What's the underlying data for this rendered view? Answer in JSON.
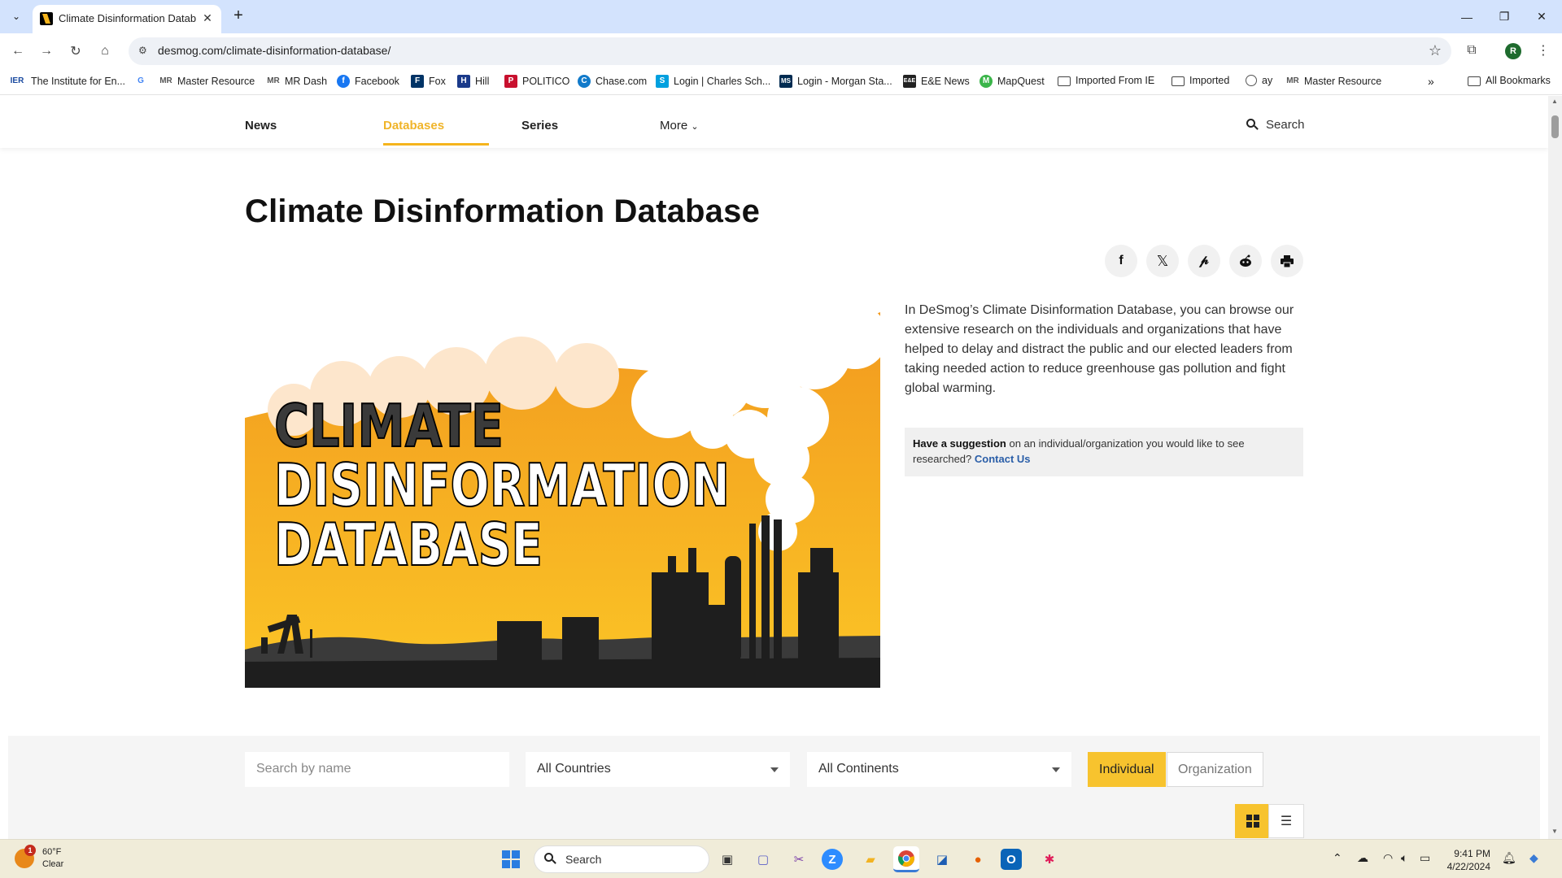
{
  "browser": {
    "tab_title": "Climate Disinformation Datab",
    "url": "desmog.com/climate-disinformation-database/",
    "profile_initial": "R"
  },
  "bookmarks": [
    {
      "label": "The Institute for En...",
      "icon": "IER"
    },
    {
      "label": "",
      "icon": "G"
    },
    {
      "label": "Master Resource",
      "icon": "MR"
    },
    {
      "label": "MR Dash",
      "icon": "MR"
    },
    {
      "label": "Facebook",
      "icon": "f"
    },
    {
      "label": "Fox",
      "icon": "F"
    },
    {
      "label": "Hill",
      "icon": "H"
    },
    {
      "label": "POLITICO",
      "icon": "P"
    },
    {
      "label": "Chase.com",
      "icon": "C"
    },
    {
      "label": "Login | Charles Sch...",
      "icon": "S"
    },
    {
      "label": "Login - Morgan Sta...",
      "icon": "MS"
    },
    {
      "label": "E&E News",
      "icon": "E&E"
    },
    {
      "label": "MapQuest",
      "icon": "M"
    },
    {
      "label": "Imported From IE",
      "icon": "folder"
    },
    {
      "label": "Imported",
      "icon": "folder"
    },
    {
      "label": "ay",
      "icon": "globe"
    },
    {
      "label": "Master Resource",
      "icon": "MR"
    }
  ],
  "all_bookmarks": "All Bookmarks",
  "site_nav": {
    "items": [
      "News",
      "Databases",
      "Series",
      "More"
    ],
    "search": "Search"
  },
  "page": {
    "title": "Climate Disinformation Database",
    "intro": "In DeSmog’s Climate Disinformation Database, you can browse our extensive research on the individuals and organizations that have helped to delay and distract the public and our elected leaders from taking needed action to reduce greenhouse gas pollution and fight global warming.",
    "suggestion_bold": "Have a suggestion",
    "suggestion_text": " on an individual/organization you would like to see researched? ",
    "suggestion_link": "Contact Us",
    "hero_lines": [
      "CLIMATE",
      "DISINFORMATION",
      "DATABASE"
    ],
    "share_icons": [
      "facebook-icon",
      "x-icon",
      "pinterest-icon",
      "reddit-icon",
      "print-icon"
    ]
  },
  "filters": {
    "search_placeholder": "Search by name",
    "countries": "All Countries",
    "continents": "All Continents",
    "individual": "Individual",
    "organization": "Organization"
  },
  "taskbar": {
    "temp": "60°F",
    "condition": "Clear",
    "weather_badge": "1",
    "search": "Search",
    "time": "9:41 PM",
    "date": "4/22/2024"
  },
  "colors": {
    "accent": "#f7c32e",
    "link": "#2a5ea8",
    "tab_bar": "#d3e3fd"
  }
}
